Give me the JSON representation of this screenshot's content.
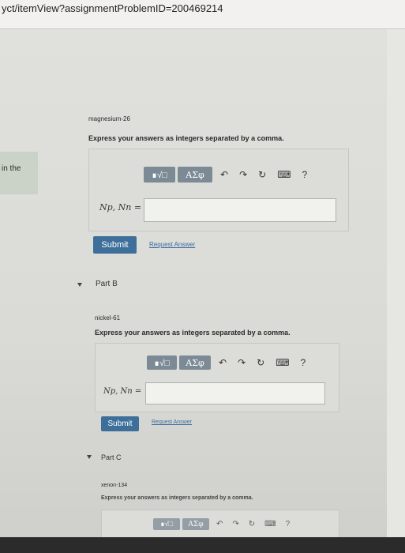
{
  "url": "yct/itemView?assignmentProblemID=200469214",
  "left_panel_text": "in the",
  "toolbar": {
    "sqrt_label": "∎√□",
    "greek_label": "ΑΣφ",
    "undo": "↶",
    "redo": "↷",
    "reset": "↻",
    "keyboard": "⌨",
    "help": "?"
  },
  "part_a": {
    "element": "magnesium-26",
    "instruction": "Express your answers as integers separated by a comma.",
    "formula": "Np, Nn =",
    "input_value": "",
    "submit_label": "Submit",
    "request_label": "Request Answer"
  },
  "part_b": {
    "title": "Part B",
    "element": "nickel-61",
    "instruction": "Express your answers as integers separated by a comma.",
    "formula": "Np, Nn =",
    "input_value": "",
    "submit_label": "Submit",
    "request_label": "Request Answer"
  },
  "part_c": {
    "title": "Part C",
    "element": "xenon-134",
    "instruction": "Express your answers as integers separated by a comma."
  }
}
